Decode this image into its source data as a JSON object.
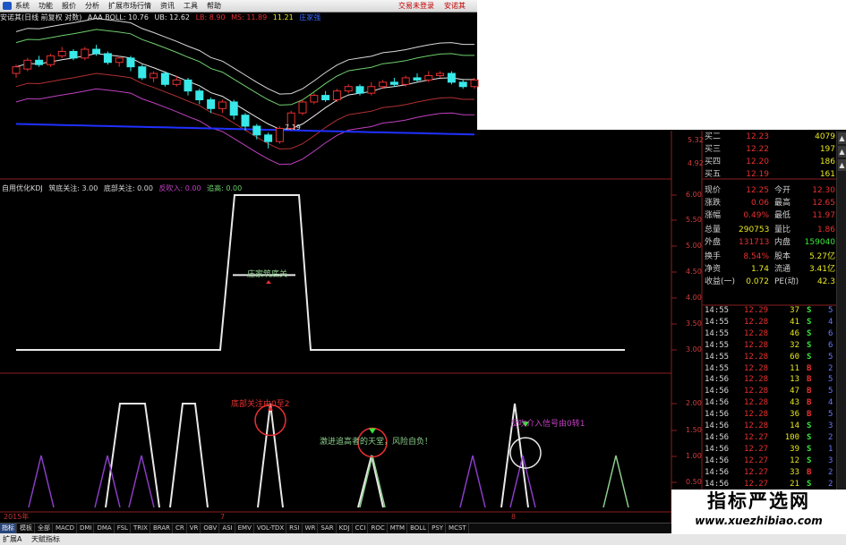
{
  "menu": {
    "items": [
      "系统",
      "功能",
      "报价",
      "分析",
      "扩展市场行情",
      "资讯",
      "工具",
      "帮助"
    ],
    "right_status": "交易未登录",
    "right_name": "安诺其"
  },
  "kline_header": {
    "name": "安诺其(日线 前复权 对数)",
    "indicator": "AAA BOLL: 10.76",
    "ub": "UB: 12.62",
    "lb": "LB: 8.90",
    "ms": "MS: 11.89",
    "extra": "11.21",
    "badge": "庄家强"
  },
  "kline": {
    "low_label": "7.19",
    "ylabels": [
      "5.32",
      "4.92"
    ],
    "candles": [
      {
        "o": 10.6,
        "c": 10.9,
        "h": 11.0,
        "l": 10.4
      },
      {
        "o": 10.8,
        "c": 11.2,
        "h": 11.3,
        "l": 10.7
      },
      {
        "o": 11.2,
        "c": 11.0,
        "h": 11.4,
        "l": 10.9
      },
      {
        "o": 11.0,
        "c": 11.4,
        "h": 11.5,
        "l": 10.9
      },
      {
        "o": 11.4,
        "c": 11.6,
        "h": 11.8,
        "l": 11.3
      },
      {
        "o": 11.6,
        "c": 11.3,
        "h": 11.7,
        "l": 11.2
      },
      {
        "o": 11.3,
        "c": 11.7,
        "h": 11.8,
        "l": 11.2
      },
      {
        "o": 11.7,
        "c": 11.5,
        "h": 11.9,
        "l": 11.4
      },
      {
        "o": 11.5,
        "c": 11.1,
        "h": 11.6,
        "l": 11.0
      },
      {
        "o": 11.1,
        "c": 11.3,
        "h": 11.4,
        "l": 10.9
      },
      {
        "o": 11.3,
        "c": 10.9,
        "h": 11.4,
        "l": 10.7
      },
      {
        "o": 10.9,
        "c": 10.4,
        "h": 11.0,
        "l": 10.3
      },
      {
        "o": 10.4,
        "c": 10.6,
        "h": 10.7,
        "l": 10.2
      },
      {
        "o": 10.6,
        "c": 10.1,
        "h": 10.7,
        "l": 10.0
      },
      {
        "o": 10.1,
        "c": 10.3,
        "h": 10.5,
        "l": 10.0
      },
      {
        "o": 10.3,
        "c": 9.8,
        "h": 10.4,
        "l": 9.6
      },
      {
        "o": 9.8,
        "c": 9.4,
        "h": 9.9,
        "l": 9.2
      },
      {
        "o": 9.4,
        "c": 9.0,
        "h": 9.5,
        "l": 8.8
      },
      {
        "o": 9.0,
        "c": 9.3,
        "h": 9.4,
        "l": 8.8
      },
      {
        "o": 9.3,
        "c": 8.7,
        "h": 9.4,
        "l": 8.5
      },
      {
        "o": 8.7,
        "c": 8.2,
        "h": 8.8,
        "l": 8.0
      },
      {
        "o": 8.2,
        "c": 7.8,
        "h": 8.3,
        "l": 7.6
      },
      {
        "o": 7.8,
        "c": 7.5,
        "h": 7.9,
        "l": 7.19
      },
      {
        "o": 7.5,
        "c": 8.1,
        "h": 8.2,
        "l": 7.4
      },
      {
        "o": 8.1,
        "c": 8.8,
        "h": 8.9,
        "l": 8.0
      },
      {
        "o": 8.8,
        "c": 9.3,
        "h": 9.4,
        "l": 8.7
      },
      {
        "o": 9.3,
        "c": 9.6,
        "h": 9.7,
        "l": 9.2
      },
      {
        "o": 9.6,
        "c": 9.4,
        "h": 9.8,
        "l": 9.3
      },
      {
        "o": 9.4,
        "c": 9.8,
        "h": 9.9,
        "l": 9.3
      },
      {
        "o": 9.8,
        "c": 10.0,
        "h": 10.1,
        "l": 9.7
      },
      {
        "o": 10.0,
        "c": 9.7,
        "h": 10.1,
        "l": 9.6
      },
      {
        "o": 9.7,
        "c": 10.0,
        "h": 10.2,
        "l": 9.6
      },
      {
        "o": 10.0,
        "c": 10.2,
        "h": 10.3,
        "l": 9.9
      },
      {
        "o": 10.2,
        "c": 10.1,
        "h": 10.4,
        "l": 10.0
      },
      {
        "o": 10.1,
        "c": 10.4,
        "h": 10.5,
        "l": 10.0
      },
      {
        "o": 10.4,
        "c": 10.3,
        "h": 10.6,
        "l": 10.2
      },
      {
        "o": 10.3,
        "c": 10.5,
        "h": 10.7,
        "l": 10.2
      },
      {
        "o": 10.5,
        "c": 10.6,
        "h": 10.7,
        "l": 10.4
      },
      {
        "o": 10.6,
        "c": 10.2,
        "h": 10.7,
        "l": 10.1
      },
      {
        "o": 10.2,
        "c": 10.0,
        "h": 10.3,
        "l": 9.9
      },
      {
        "o": 10.0,
        "c": 10.3,
        "h": 10.4,
        "l": 9.9
      }
    ]
  },
  "kdj_header": {
    "name": "自用优化KDJ",
    "a": "筑底关注: 3.00",
    "b": "底部关注: 0.00",
    "c": "反吹入: 0.00",
    "d": "追高: 0.00"
  },
  "upper_ind": {
    "ylabels": [
      "6.00",
      "5.50",
      "5.00",
      "4.50",
      "4.00",
      "3.50",
      "3.00"
    ],
    "label": "庄家筑底关"
  },
  "lower_ind": {
    "ylabels": [
      "2.00",
      "1.50",
      "1.00",
      "0.50"
    ],
    "ann1": "底部关注由0至2",
    "ann2": "激进追高者的天堂，风险自负！",
    "ann3": "反吹介入信号由0转1"
  },
  "quotes": {
    "rows": [
      {
        "k": "买二",
        "v": "12.23",
        "v2": "4079",
        "c": "#e8e820"
      },
      {
        "k": "买三",
        "v": "12.22",
        "v2": "197",
        "c": "#e8e820"
      },
      {
        "k": "买四",
        "v": "12.20",
        "v2": "186",
        "c": "#e8e820"
      },
      {
        "k": "买五",
        "v": "12.19",
        "v2": "161",
        "c": "#e8e820"
      }
    ],
    "stats": [
      {
        "k": "现价",
        "v": "12.25",
        "k2": "今开",
        "v2": "12.30"
      },
      {
        "k": "涨跌",
        "v": "0.06",
        "k2": "最高",
        "v2": "12.65"
      },
      {
        "k": "涨幅",
        "v": "0.49%",
        "k2": "最低",
        "v2": "11.97"
      },
      {
        "k": "总量",
        "v": "290753",
        "k2": "量比",
        "v2": "1.86"
      },
      {
        "k": "外盘",
        "v": "131713",
        "k2": "内盘",
        "v2": "159040"
      },
      {
        "k": "换手",
        "v": "8.54%",
        "k2": "股本",
        "v2": "5.27亿"
      },
      {
        "k": "净资",
        "v": "1.74",
        "k2": "流通",
        "v2": "3.41亿"
      },
      {
        "k": "收益(一)",
        "v": "0.072",
        "k2": "PE(动)",
        "v2": "42.3"
      }
    ]
  },
  "ticks": [
    {
      "t": "14:55",
      "p": "12.29",
      "v": "37",
      "s": "S",
      "n": "5"
    },
    {
      "t": "14:55",
      "p": "12.28",
      "v": "41",
      "s": "S",
      "n": "4"
    },
    {
      "t": "14:55",
      "p": "12.28",
      "v": "46",
      "s": "S",
      "n": "6"
    },
    {
      "t": "14:55",
      "p": "12.28",
      "v": "32",
      "s": "S",
      "n": "6"
    },
    {
      "t": "14:55",
      "p": "12.28",
      "v": "60",
      "s": "S",
      "n": "5"
    },
    {
      "t": "14:55",
      "p": "12.28",
      "v": "11",
      "s": "B",
      "n": "2"
    },
    {
      "t": "14:56",
      "p": "12.28",
      "v": "13",
      "s": "B",
      "n": "5"
    },
    {
      "t": "14:56",
      "p": "12.28",
      "v": "47",
      "s": "B",
      "n": "5"
    },
    {
      "t": "14:56",
      "p": "12.28",
      "v": "43",
      "s": "B",
      "n": "4"
    },
    {
      "t": "14:56",
      "p": "12.28",
      "v": "36",
      "s": "B",
      "n": "5"
    },
    {
      "t": "14:56",
      "p": "12.28",
      "v": "14",
      "s": "S",
      "n": "3"
    },
    {
      "t": "14:56",
      "p": "12.27",
      "v": "100",
      "s": "S",
      "n": "2"
    },
    {
      "t": "14:56",
      "p": "12.27",
      "v": "39",
      "s": "S",
      "n": "1"
    },
    {
      "t": "14:56",
      "p": "12.27",
      "v": "12",
      "s": "S",
      "n": "3"
    },
    {
      "t": "14:56",
      "p": "12.27",
      "v": "33",
      "s": "B",
      "n": "2"
    },
    {
      "t": "14:56",
      "p": "12.27",
      "v": "21",
      "s": "S",
      "n": "2"
    },
    {
      "t": "14:56",
      "p": "12.26",
      "v": "107",
      "s": "S",
      "n": "5"
    },
    {
      "t": "14:56",
      "p": "12.27",
      "v": "33",
      "s": "B",
      "n": "3"
    },
    {
      "t": "14:56",
      "p": "12.27",
      "v": "12",
      "s": "B",
      "n": "1"
    }
  ],
  "datebar": {
    "year": "2015年",
    "m7": "7",
    "m8": "8"
  },
  "bottom_tabs": [
    "指标",
    "模板",
    "全部",
    "MACD",
    "DMI",
    "DMA",
    "FSL",
    "TRIX",
    "BRAR",
    "CR",
    "VR",
    "OBV",
    "ASI",
    "EMV",
    "VOL-TDX",
    "RSI",
    "WR",
    "SAR",
    "KDJ",
    "CCI",
    "ROC",
    "MTM",
    "BOLL",
    "PSY",
    "MCST"
  ],
  "status": {
    "left": "扩展A",
    "right": "天赋指标"
  },
  "watermark": {
    "title": "指标严选网",
    "url": "www.xuezhibiao.com"
  },
  "colors": {
    "up": "#e83030",
    "down": "#39e8e8",
    "boll_mid": "#e8e8e8",
    "boll_ub": "#6ecf6e",
    "boll_lb": "#c040c0",
    "ma_blue": "#2030ff",
    "kdj_purple": "#8a3cc8",
    "kdj_green": "#8ccf8c"
  }
}
